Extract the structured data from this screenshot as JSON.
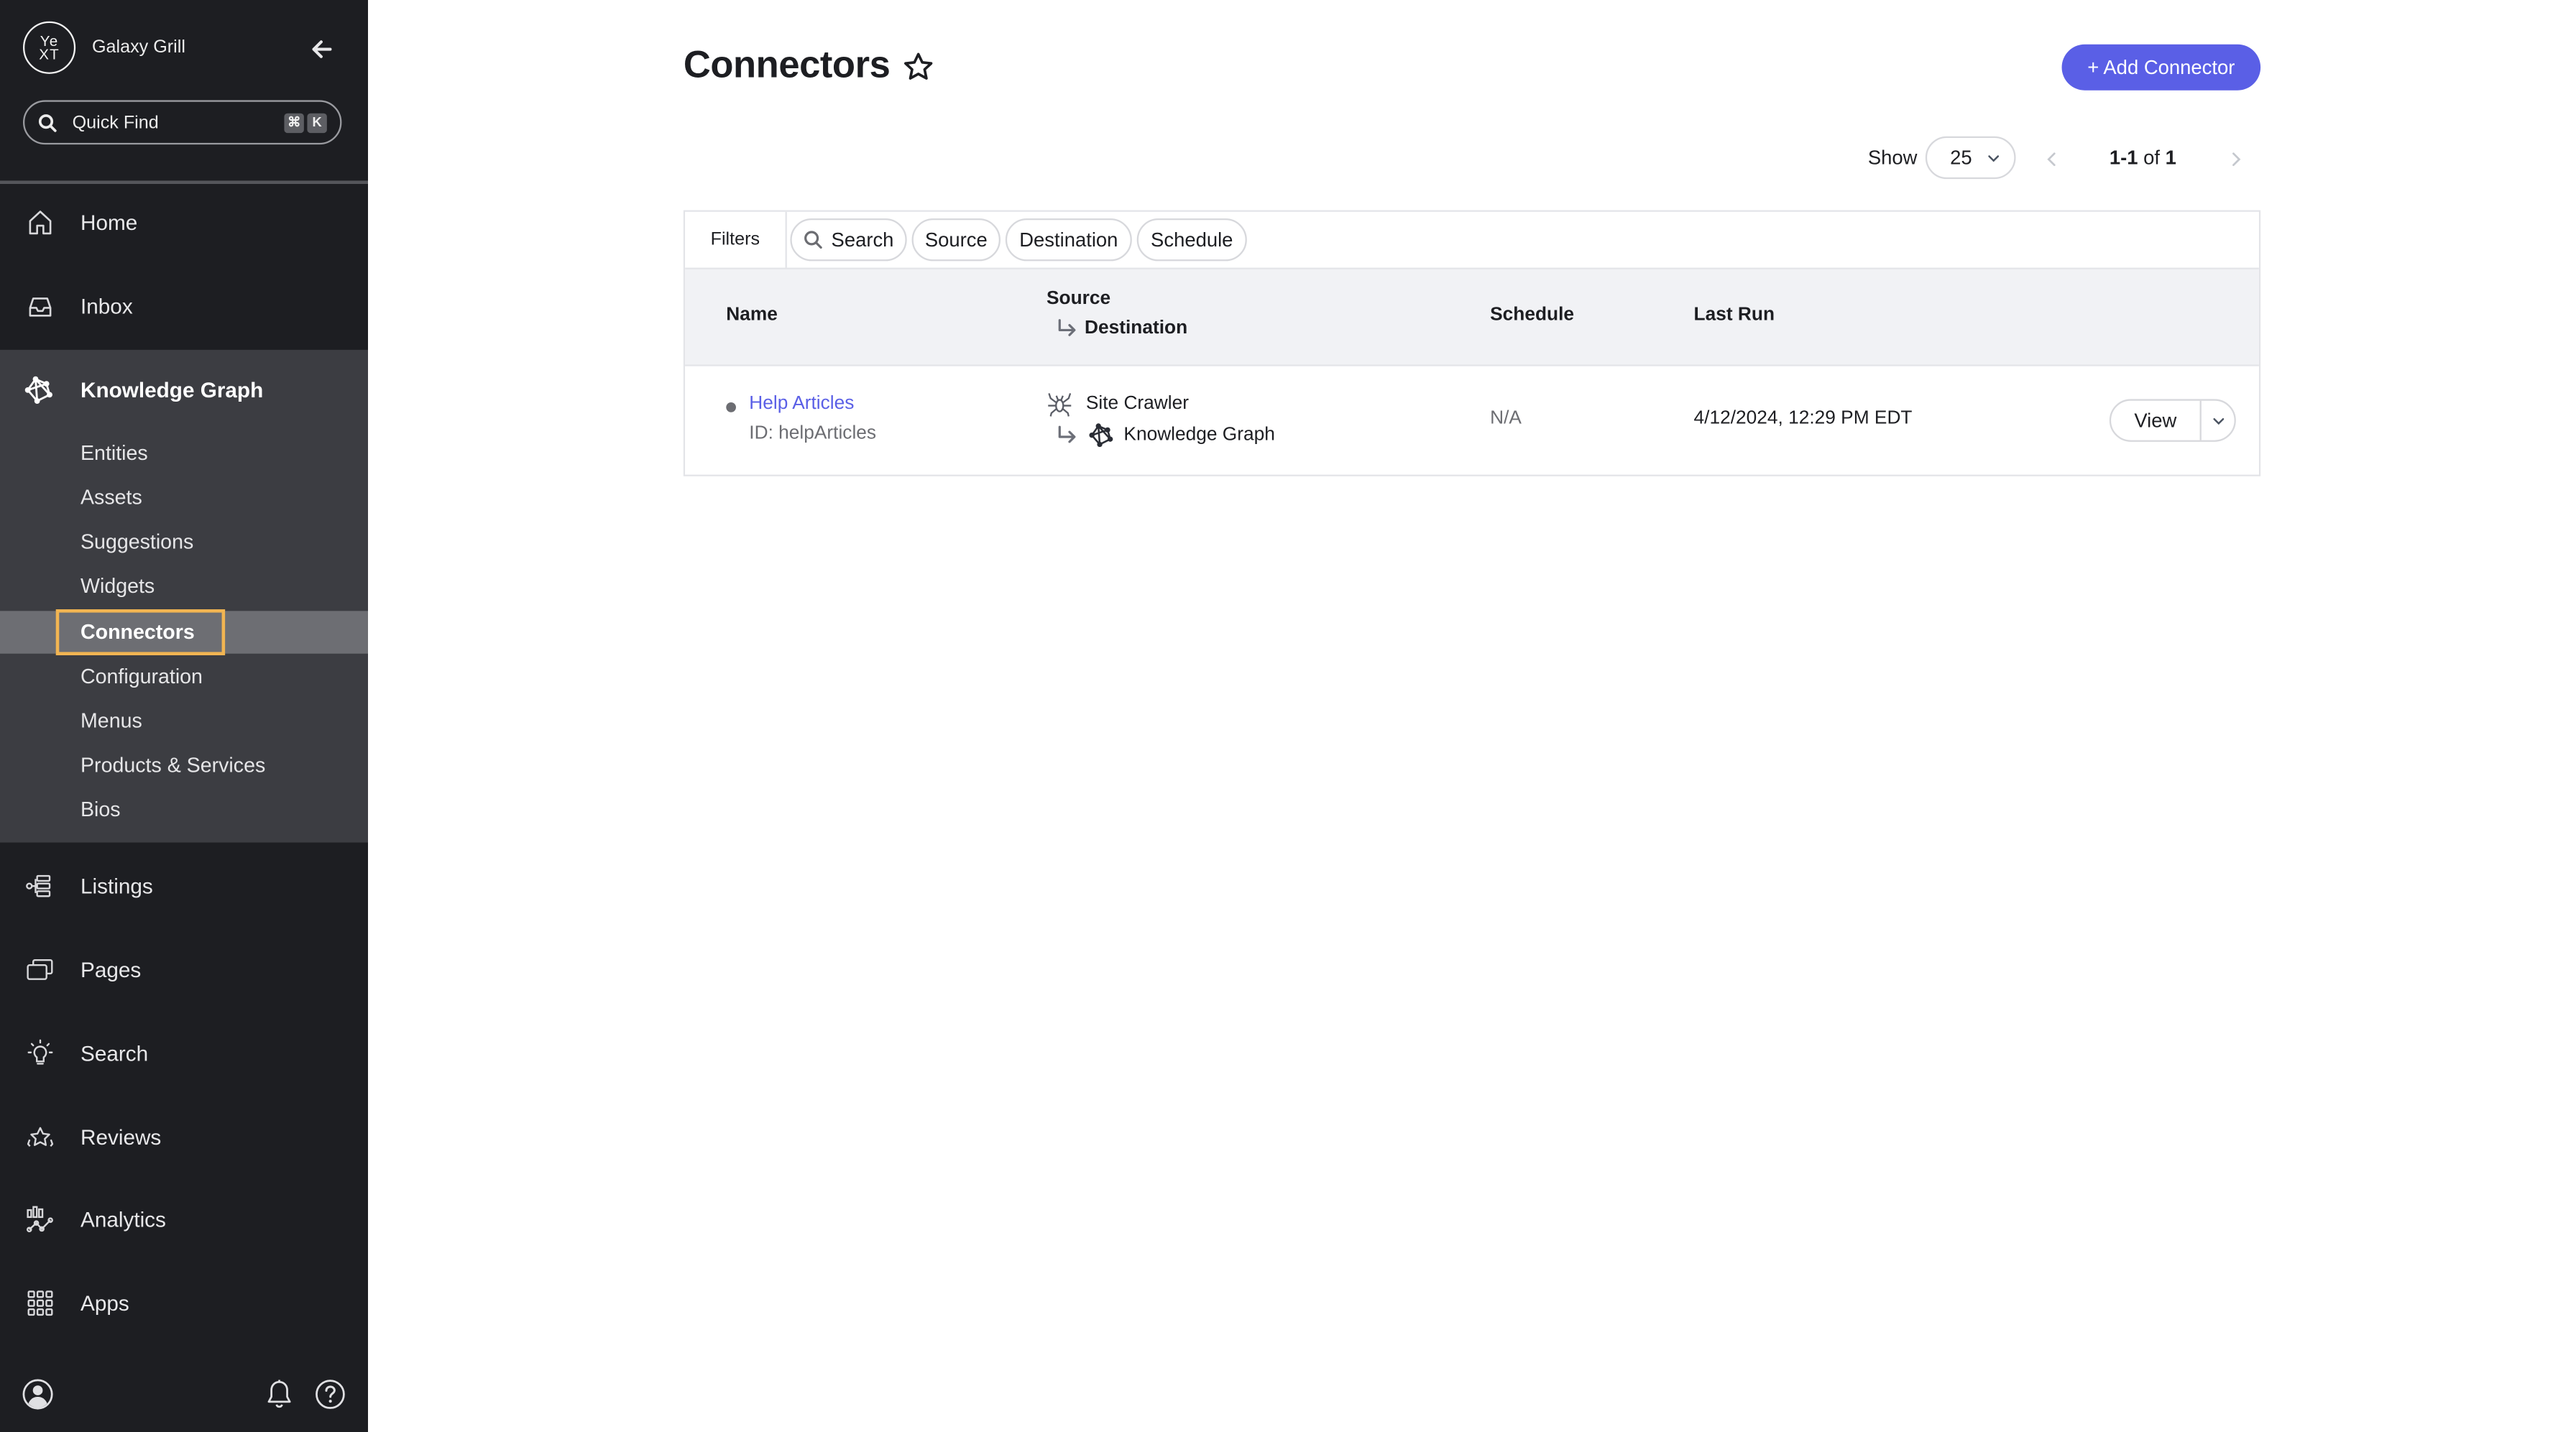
{
  "sidebar": {
    "account_name": "Galaxy Grill",
    "logo_text_top": "Ye",
    "logo_text_bottom": "XT",
    "quick_find": {
      "placeholder": "Quick Find",
      "shortcut_keys": [
        "⌘",
        "K"
      ]
    },
    "nav_items": [
      {
        "label": "Home",
        "icon": "home-icon"
      },
      {
        "label": "Inbox",
        "icon": "inbox-icon"
      },
      {
        "label": "Knowledge Graph",
        "icon": "knowledge-graph-icon",
        "expanded": true
      },
      {
        "label": "Listings",
        "icon": "listings-icon"
      },
      {
        "label": "Pages",
        "icon": "pages-icon"
      },
      {
        "label": "Search",
        "icon": "lightbulb-icon"
      },
      {
        "label": "Reviews",
        "icon": "reviews-star-icon"
      },
      {
        "label": "Analytics",
        "icon": "analytics-icon"
      },
      {
        "label": "Apps",
        "icon": "apps-grid-icon"
      }
    ],
    "kg_sub_items": [
      {
        "label": "Entities"
      },
      {
        "label": "Assets"
      },
      {
        "label": "Suggestions"
      },
      {
        "label": "Widgets"
      },
      {
        "label": "Connectors",
        "active": true
      },
      {
        "label": "Configuration"
      },
      {
        "label": "Menus"
      },
      {
        "label": "Products & Services"
      },
      {
        "label": "Bios"
      }
    ],
    "footer_icons": [
      "user-avatar-icon",
      "bell-icon",
      "help-icon"
    ]
  },
  "header": {
    "title": "Connectors",
    "add_button_label": "+ Add Connector"
  },
  "pagination": {
    "show_label": "Show",
    "page_size": "25",
    "range": "1-1",
    "of_label": "of",
    "total": "1"
  },
  "filters": {
    "label": "Filters",
    "chips": [
      "Search",
      "Source",
      "Destination",
      "Schedule"
    ]
  },
  "table": {
    "columns": {
      "name": "Name",
      "source": "Source",
      "destination": "Destination",
      "schedule": "Schedule",
      "last_run": "Last Run"
    },
    "rows": [
      {
        "name": "Help Articles",
        "id_text": "ID: helpArticles",
        "source": "Site Crawler",
        "source_icon": "spider-icon",
        "destination": "Knowledge Graph",
        "destination_icon": "knowledge-graph-icon",
        "schedule": "N/A",
        "last_run": "4/12/2024, 12:29 PM EDT",
        "action_label": "View"
      }
    ]
  },
  "colors": {
    "sidebar_bg": "#1d1e22",
    "sidebar_section_bg": "#3c3d42",
    "active_item_bg": "#6d6e73",
    "highlight_outline": "#f2b552",
    "accent": "#5a5fe6",
    "table_header_bg": "#f1f2f5"
  }
}
